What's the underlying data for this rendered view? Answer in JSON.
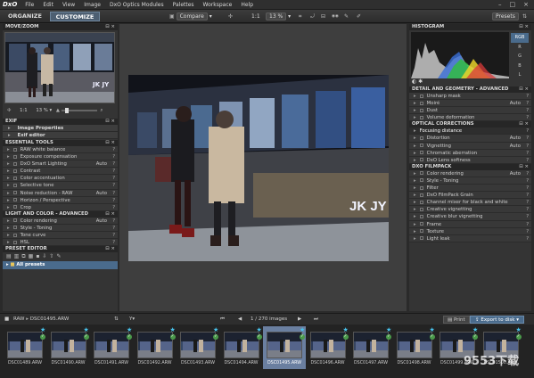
{
  "app": {
    "logo": "DxO"
  },
  "menu": [
    "File",
    "Edit",
    "View",
    "Image",
    "DxO Optics Modules",
    "Palettes",
    "Workspace",
    "Help"
  ],
  "tabs": {
    "organize": "ORGANIZE",
    "customize": "CUSTOMIZE"
  },
  "toolbar": {
    "compare": "Compare",
    "zoom_ratio": "1:1",
    "zoom_pct": "13 %",
    "presets": "Presets",
    "view_mode": "RAW"
  },
  "move_zoom": {
    "title": "MOVE/ZOOM",
    "ratio": "1:1",
    "pct": "13 %"
  },
  "left_panels": {
    "exif": "EXIF",
    "exif_items": [
      "Image Properties",
      "Exif editor"
    ],
    "essential": "ESSENTIAL TOOLS",
    "essential_items": [
      {
        "label": "RAW white balance",
        "val": ""
      },
      {
        "label": "Exposure compensation",
        "val": ""
      },
      {
        "label": "DxO Smart Lighting",
        "val": "Auto"
      },
      {
        "label": "Contrast",
        "val": ""
      },
      {
        "label": "Color accentuation",
        "val": ""
      },
      {
        "label": "Selective tone",
        "val": ""
      },
      {
        "label": "Noise reduction - RAW",
        "val": "Auto"
      },
      {
        "label": "Horizon / Perspective",
        "val": ""
      },
      {
        "label": "Crop",
        "val": ""
      }
    ],
    "light_color": "LIGHT AND COLOR - ADVANCED",
    "light_items": [
      {
        "label": "Color rendering",
        "val": "Auto"
      },
      {
        "label": "Style - Toning",
        "val": ""
      },
      {
        "label": "Tone curve",
        "val": ""
      },
      {
        "label": "HSL",
        "val": ""
      }
    ],
    "preset_editor": "PRESET EDITOR",
    "all_presets": "All presets"
  },
  "right_panels": {
    "histogram": "HISTOGRAM",
    "channels": [
      "RGB",
      "R",
      "G",
      "B",
      "L"
    ],
    "detail": "DETAIL AND GEOMETRY - ADVANCED",
    "detail_items": [
      {
        "label": "Unsharp mask",
        "val": ""
      },
      {
        "label": "Moiré",
        "val": "Auto"
      },
      {
        "label": "Dust",
        "val": ""
      },
      {
        "label": "Volume deformation",
        "val": ""
      }
    ],
    "optical": "OPTICAL CORRECTIONS",
    "optical_items": [
      {
        "label": "Focusing distance",
        "val": "",
        "sub": true
      },
      {
        "label": "Distortion",
        "val": "Auto"
      },
      {
        "label": "Vignetting",
        "val": "Auto"
      },
      {
        "label": "Chromatic aberration",
        "val": ""
      },
      {
        "label": "DxO Lens softness",
        "val": ""
      }
    ],
    "filmpack": "DXO FILMPACK",
    "filmpack_items": [
      {
        "label": "Color rendering",
        "val": "Auto"
      },
      {
        "label": "Style - Toning",
        "val": ""
      },
      {
        "label": "Filter",
        "val": ""
      },
      {
        "label": "DxO FilmPack Grain",
        "val": ""
      },
      {
        "label": "Channel mixer for black and white",
        "val": ""
      },
      {
        "label": "Creative vignetting",
        "val": ""
      },
      {
        "label": "Creative blur vignetting",
        "val": ""
      },
      {
        "label": "Frame",
        "val": ""
      },
      {
        "label": "Texture",
        "val": ""
      },
      {
        "label": "Light leak",
        "val": ""
      }
    ]
  },
  "photo": {
    "sign": "JK JY"
  },
  "strip": {
    "path_root": "RAW",
    "path_file": "DSC01495.ARW",
    "page": "1 / 270",
    "page_label": "images",
    "print": "Print",
    "export": "Export to disk"
  },
  "thumbs": [
    "DSC01489.ARW",
    "DSC01490.ARW",
    "DSC01491.ARW",
    "DSC01492.ARW",
    "DSC01493.ARW",
    "DSC01494.ARW",
    "DSC01495.ARW",
    "DSC01496.ARW",
    "DSC01497.ARW",
    "DSC01498.ARW",
    "DSC01499.ARW",
    "DSC01500.ARW"
  ],
  "watermark": "9553下载"
}
